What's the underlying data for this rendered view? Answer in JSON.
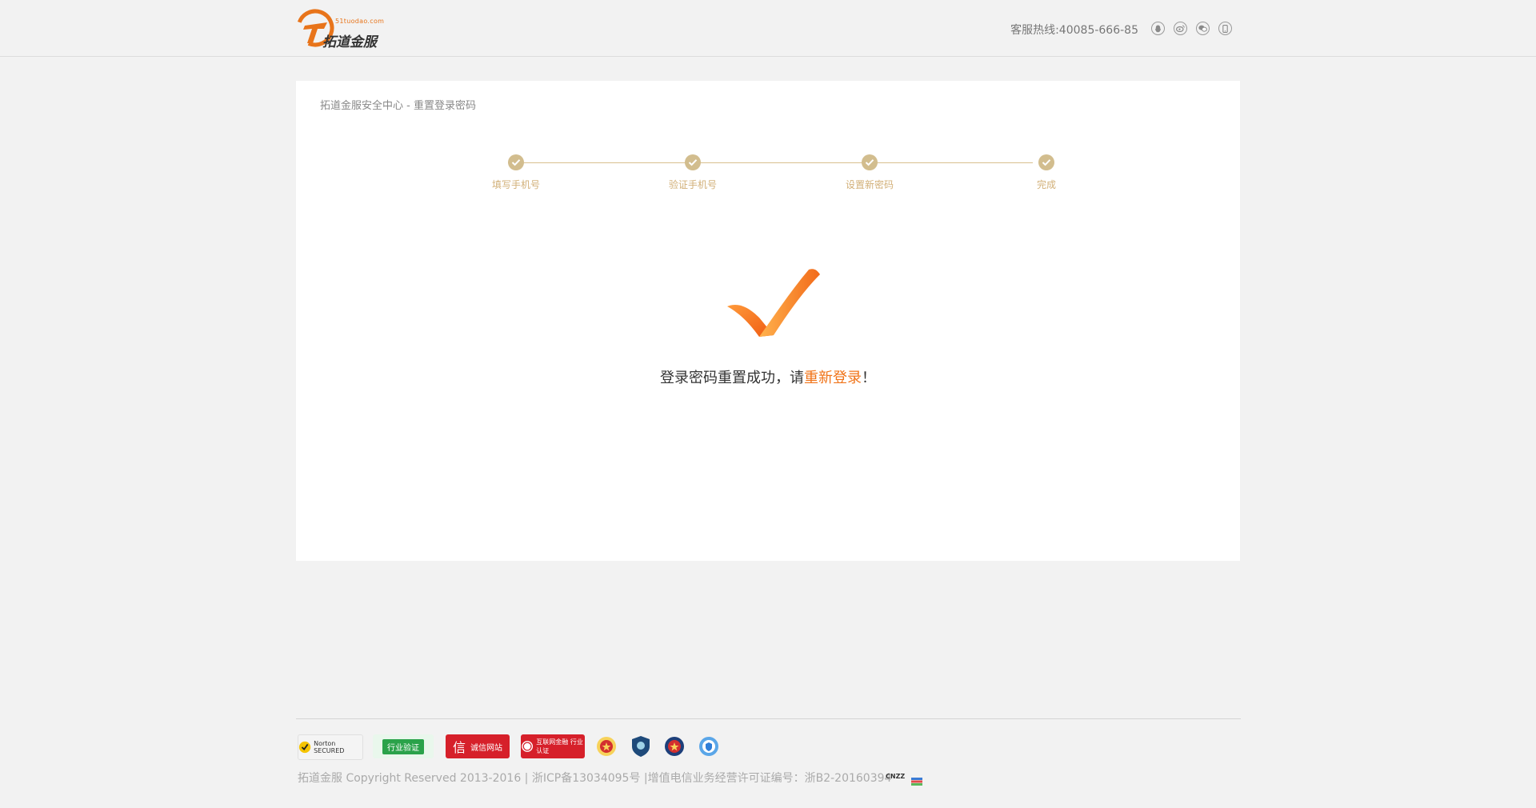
{
  "header": {
    "logo_domain": "51tuodao.com",
    "logo_name": "拓道金服",
    "hotline": "客服热线:40085-666-85",
    "social_icons": [
      "qq-icon",
      "weibo-icon",
      "wechat-icon",
      "mobile-icon"
    ]
  },
  "breadcrumb": "拓道金服安全中心 - 重置登录密码",
  "steps": [
    {
      "label": "填写手机号"
    },
    {
      "label": "验证手机号"
    },
    {
      "label": "设置新密码"
    },
    {
      "label": "完成"
    }
  ],
  "result": {
    "prefix": "登录密码重置成功，请",
    "link": "重新登录",
    "suffix": "！"
  },
  "footer": {
    "badges": [
      {
        "name": "norton-secured-badge",
        "text": "Norton SECURED"
      },
      {
        "name": "industry-verified-badge",
        "text": "行业验证"
      },
      {
        "name": "trusted-website-badge",
        "text": "诚信网站"
      },
      {
        "name": "internet-finance-badge",
        "text": "互联网金融 行业认证"
      },
      {
        "name": "police-badge-1",
        "text": ""
      },
      {
        "name": "shield-badge",
        "text": ""
      },
      {
        "name": "police-badge-2",
        "text": ""
      },
      {
        "name": "security-badge",
        "text": ""
      }
    ],
    "copyright": "拓道金服 Copyright Reserved 2013-2016 | 浙ICP备13034095号 |增值电信业务经营许可证编号：浙B2-20160394",
    "cnzz": "CNZZ"
  },
  "colors": {
    "accent": "#f07318",
    "step_gold": "#d2bd8e",
    "background": "#f2f2f2"
  }
}
